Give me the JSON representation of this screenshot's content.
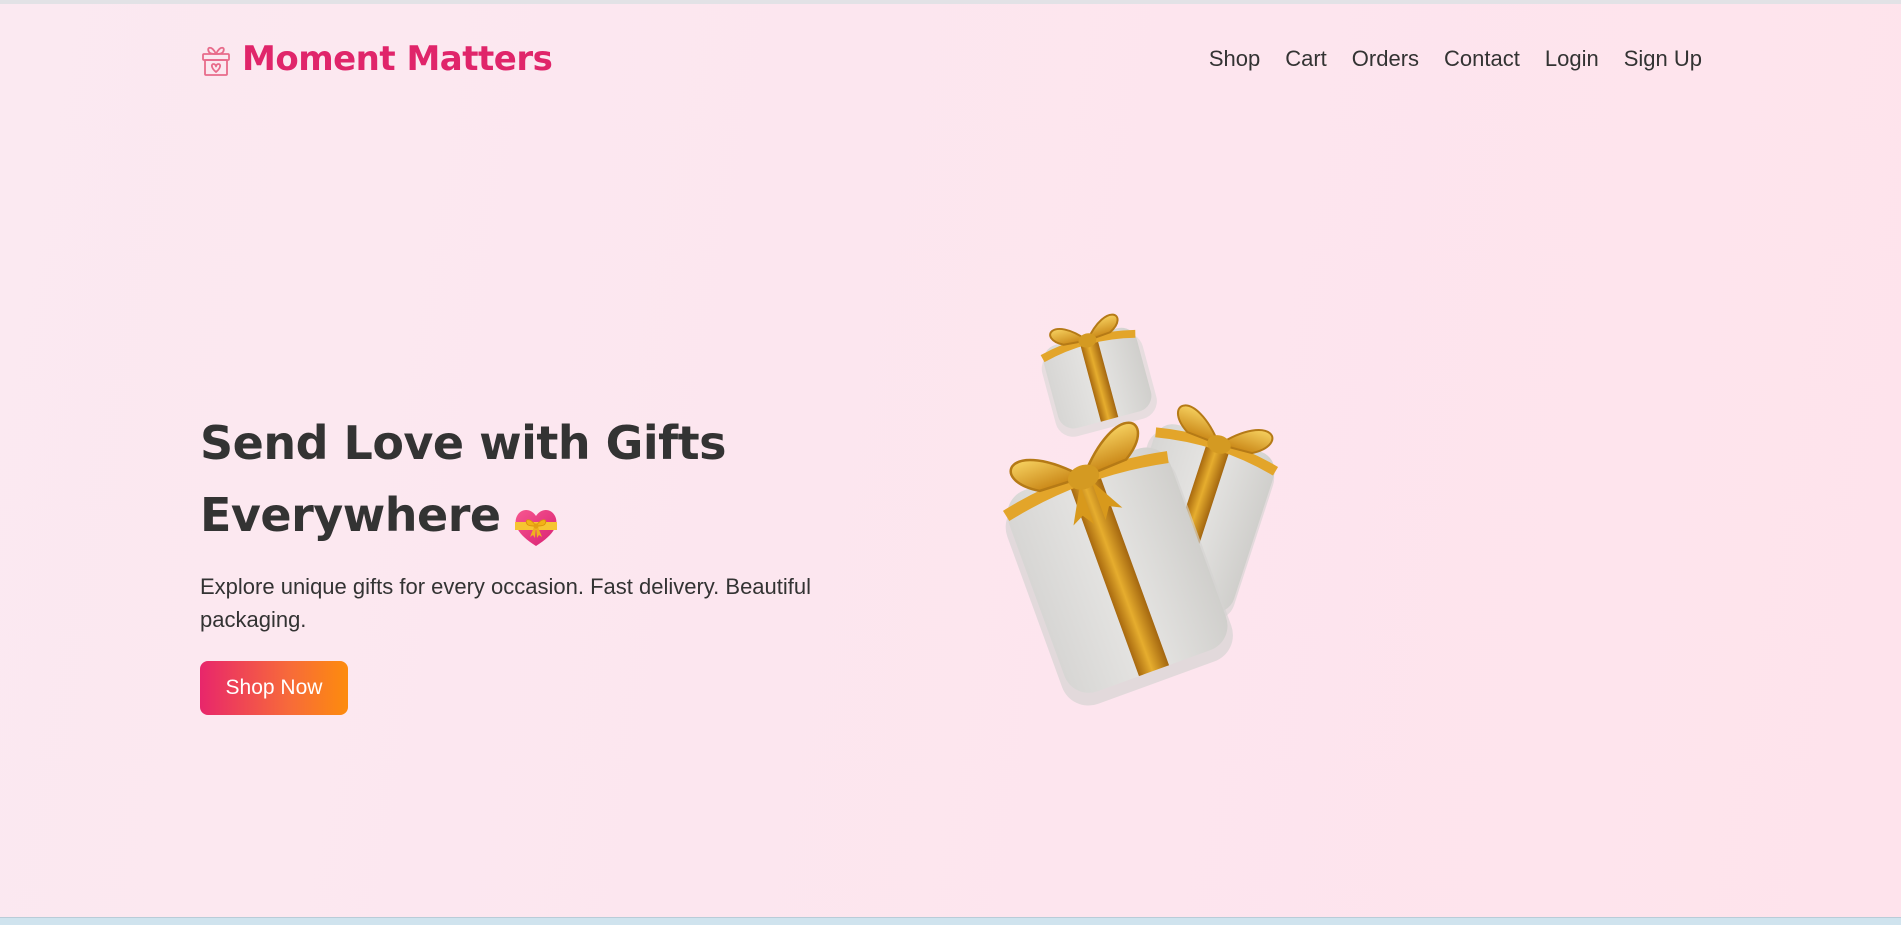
{
  "brand": {
    "name": "Moment Matters",
    "icon": "gift-heart-icon",
    "color": "#e0256a"
  },
  "nav": {
    "items": [
      {
        "label": "Shop"
      },
      {
        "label": "Cart"
      },
      {
        "label": "Orders"
      },
      {
        "label": "Contact"
      },
      {
        "label": "Login"
      },
      {
        "label": "Sign Up"
      }
    ]
  },
  "hero": {
    "title_line1": "Send Love with Gifts",
    "title_line2": "Everywhere",
    "title_emoji": "heart-with-ribbon-icon",
    "subtitle": "Explore unique gifts for every occasion. Fast delivery. Beautiful packaging.",
    "cta_label": "Shop Now",
    "cta_gradient": [
      "#e8266b",
      "#fd8c0d"
    ],
    "illustration": "gift-boxes-illustration"
  },
  "colors": {
    "background": "#fde8f0",
    "text": "#333333",
    "gold": "#d99a1c"
  }
}
